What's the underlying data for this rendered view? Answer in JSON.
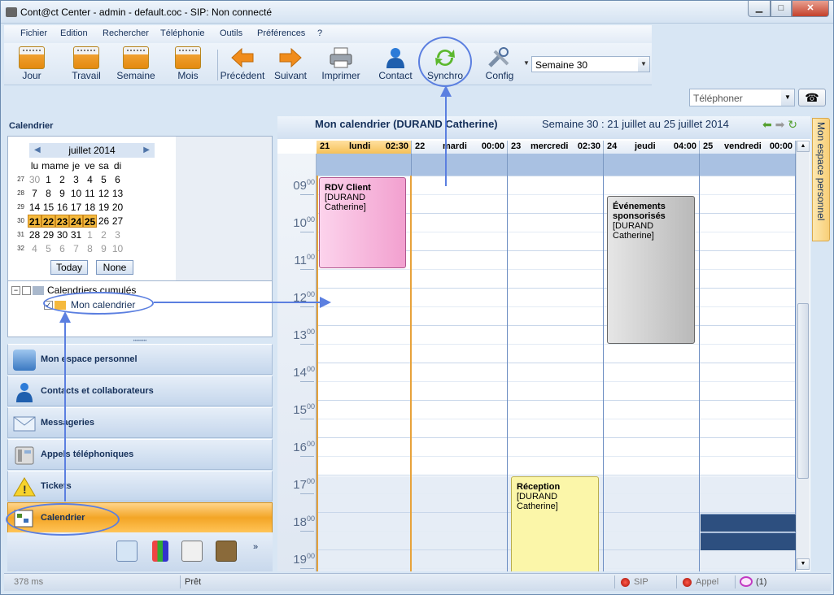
{
  "window": {
    "title": "Cont@ct Center - admin - default.coc - SIP: Non connecté"
  },
  "menu": [
    "Fichier",
    "Edition",
    "Rechercher",
    "Téléphonie",
    "Outils",
    "Préférences",
    "?"
  ],
  "toolbar": {
    "jour": "Jour",
    "travail": "Travail",
    "semaine": "Semaine",
    "mois": "Mois",
    "precedent": "Précédent",
    "suivant": "Suivant",
    "imprimer": "Imprimer",
    "contact": "Contact",
    "synchro": "Synchro",
    "config": "Config",
    "week_select": "Semaine 30"
  },
  "phone": {
    "select": "Téléphoner"
  },
  "left": {
    "title": "Calendrier",
    "minical": {
      "month": "juillet 2014",
      "days": [
        "lu",
        "ma",
        "me",
        "je",
        "ve",
        "sa",
        "di"
      ],
      "weeks": [
        {
          "wk": "27",
          "d": [
            "30",
            "1",
            "2",
            "3",
            "4",
            "5",
            "6"
          ]
        },
        {
          "wk": "28",
          "d": [
            "7",
            "8",
            "9",
            "10",
            "11",
            "12",
            "13"
          ]
        },
        {
          "wk": "29",
          "d": [
            "14",
            "15",
            "16",
            "17",
            "18",
            "19",
            "20"
          ]
        },
        {
          "wk": "30",
          "d": [
            "21",
            "22",
            "23",
            "24",
            "25",
            "26",
            "27"
          ]
        },
        {
          "wk": "31",
          "d": [
            "28",
            "29",
            "30",
            "31",
            "1",
            "2",
            "3"
          ]
        },
        {
          "wk": "32",
          "d": [
            "4",
            "5",
            "6",
            "7",
            "8",
            "9",
            "10"
          ]
        }
      ],
      "today": "Today",
      "none": "None"
    },
    "tree": {
      "root": "Calendriers cumulés",
      "child": "Mon calendrier"
    },
    "nav": [
      "Mon espace personnel",
      "Contacts et collaborateurs",
      "Messageries",
      "Appels téléphoniques",
      "Tickets",
      "Calendrier"
    ]
  },
  "calendar": {
    "title": "Mon calendrier (DURAND Catherine)",
    "range": "Semaine 30 :  21 juillet au 25 juillet 2014",
    "days": [
      {
        "num": "21",
        "name": "lundi",
        "time": "02:30"
      },
      {
        "num": "22",
        "name": "mardi",
        "time": "00:00"
      },
      {
        "num": "23",
        "name": "mercredi",
        "time": "02:30"
      },
      {
        "num": "24",
        "name": "jeudi",
        "time": "04:00"
      },
      {
        "num": "25",
        "name": "vendredi",
        "time": "00:00"
      }
    ],
    "hours": [
      "09",
      "10",
      "11",
      "12",
      "13",
      "14",
      "15",
      "16",
      "17",
      "18",
      "19"
    ],
    "minutes": "00",
    "events": [
      {
        "title": "RDV Client",
        "who": "[DURAND Catherine]"
      },
      {
        "title": "Événements sponsorisés",
        "who": "[DURAND Catherine]"
      },
      {
        "title": "Réception",
        "who": "[DURAND Catherine]"
      }
    ]
  },
  "sidetab": "Mon espace personnel",
  "status": {
    "ms": "378 ms",
    "state": "Prêt",
    "sip": "SIP",
    "appel": "Appel",
    "count": "(1)"
  }
}
